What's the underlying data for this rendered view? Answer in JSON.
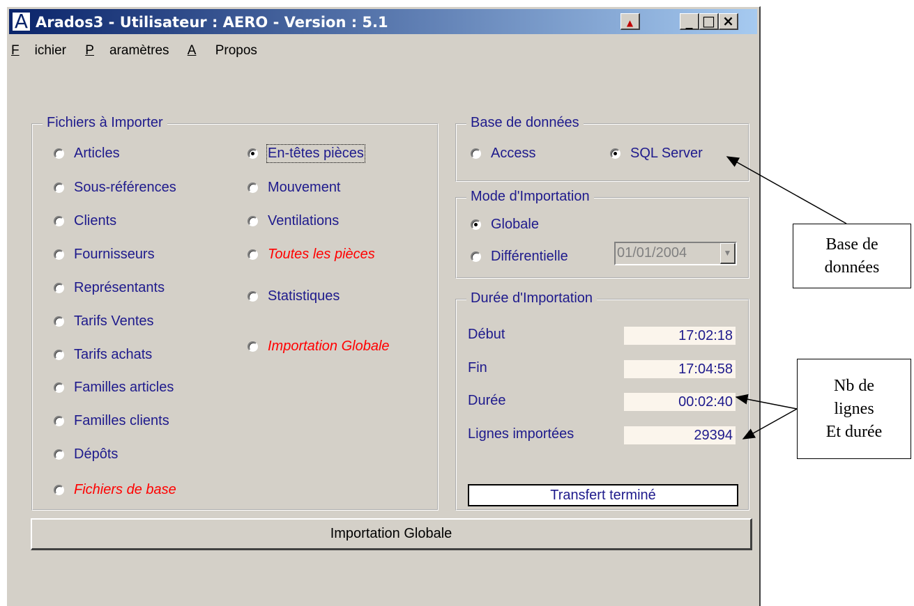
{
  "window": {
    "title": "Arados3 - Utilisateur : AERO - Version : 5.1",
    "icon_letter": "A"
  },
  "menu": [
    "Fichier",
    "Paramètres",
    "A Propos"
  ],
  "files_group": {
    "legend": "Fichiers à Importer",
    "left": [
      "Articles",
      "Sous-références",
      "Clients",
      "Fournisseurs",
      "Représentants",
      "Tarifs Ventes",
      "Tarifs achats",
      "Familles articles",
      "Familles clients",
      "Dépôts",
      "Fichiers de base"
    ],
    "right": [
      "En-têtes pièces",
      "Mouvement",
      "Ventilations",
      "Toutes les pièces",
      "Statistiques",
      "Importation Globale"
    ],
    "selected": "En-têtes pièces"
  },
  "db_group": {
    "legend": "Base de données",
    "options": [
      "Access",
      "SQL Server"
    ],
    "selected": "SQL Server"
  },
  "mode_group": {
    "legend": "Mode d'Importation",
    "options": [
      "Globale",
      "Différentielle"
    ],
    "selected": "Globale",
    "date": "01/01/2004"
  },
  "duration_group": {
    "legend": "Durée d'Importation",
    "debut_label": "Début",
    "debut_value": "17:02:18",
    "fin_label": "Fin",
    "fin_value": "17:04:58",
    "duree_label": "Durée",
    "duree_value": "00:02:40",
    "lignes_label": "Lignes importées",
    "lignes_value": "29394",
    "status": "Transfert terminé"
  },
  "main_button": "Importation Globale",
  "callouts": {
    "db": [
      "Base de",
      "données"
    ],
    "lines": [
      "Nb de",
      "lignes",
      "Et durée"
    ]
  },
  "colors": {
    "title_start": "#0a246a",
    "title_end": "#a6caf0",
    "label_blue": "#1e1a8c",
    "highlight_red": "#ff0000",
    "face": "#d4d0c8"
  }
}
